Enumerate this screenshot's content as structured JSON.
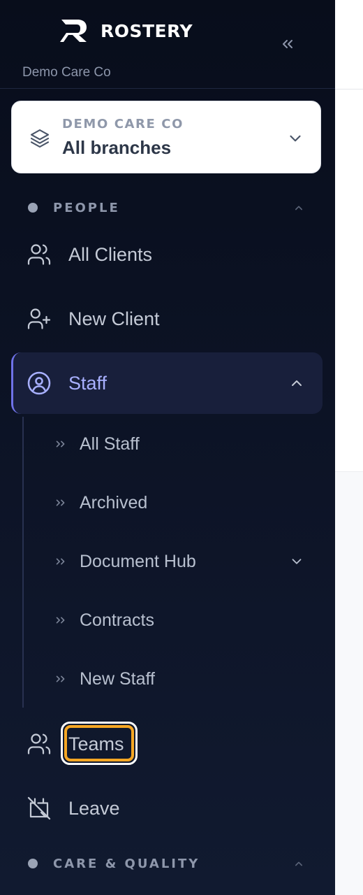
{
  "brand": {
    "name": "ROSTERY",
    "org_subtitle": "Demo Care Co"
  },
  "branch_selector": {
    "org": "DEMO CARE CO",
    "branch": "All branches"
  },
  "sections": [
    {
      "title": "PEOPLE",
      "expanded": true
    },
    {
      "title": "CARE & QUALITY",
      "expanded": true
    }
  ],
  "nav": {
    "all_clients": "All Clients",
    "new_client": "New Client",
    "staff": "Staff",
    "teams": "Teams",
    "leave": "Leave"
  },
  "staff_sub": {
    "all_staff": "All Staff",
    "archived": "Archived",
    "document_hub": "Document Hub",
    "contracts": "Contracts",
    "new_staff": "New Staff"
  },
  "icons": {
    "logo": "rostery-logo-icon",
    "collapse": "chevrons-left-icon",
    "branch": "layers-icon",
    "clients": "users-icon",
    "new_client": "user-plus-icon",
    "staff": "user-circle-icon",
    "sub": "chevrons-right-icon",
    "teams": "users-icon",
    "leave": "calendar-off-icon"
  },
  "colors": {
    "sidebar_bg": "#0b1122",
    "active_bg": "#181f3b",
    "active_text": "#a8b0ff",
    "active_border": "#6f72e8",
    "highlight": "#f5a623"
  }
}
